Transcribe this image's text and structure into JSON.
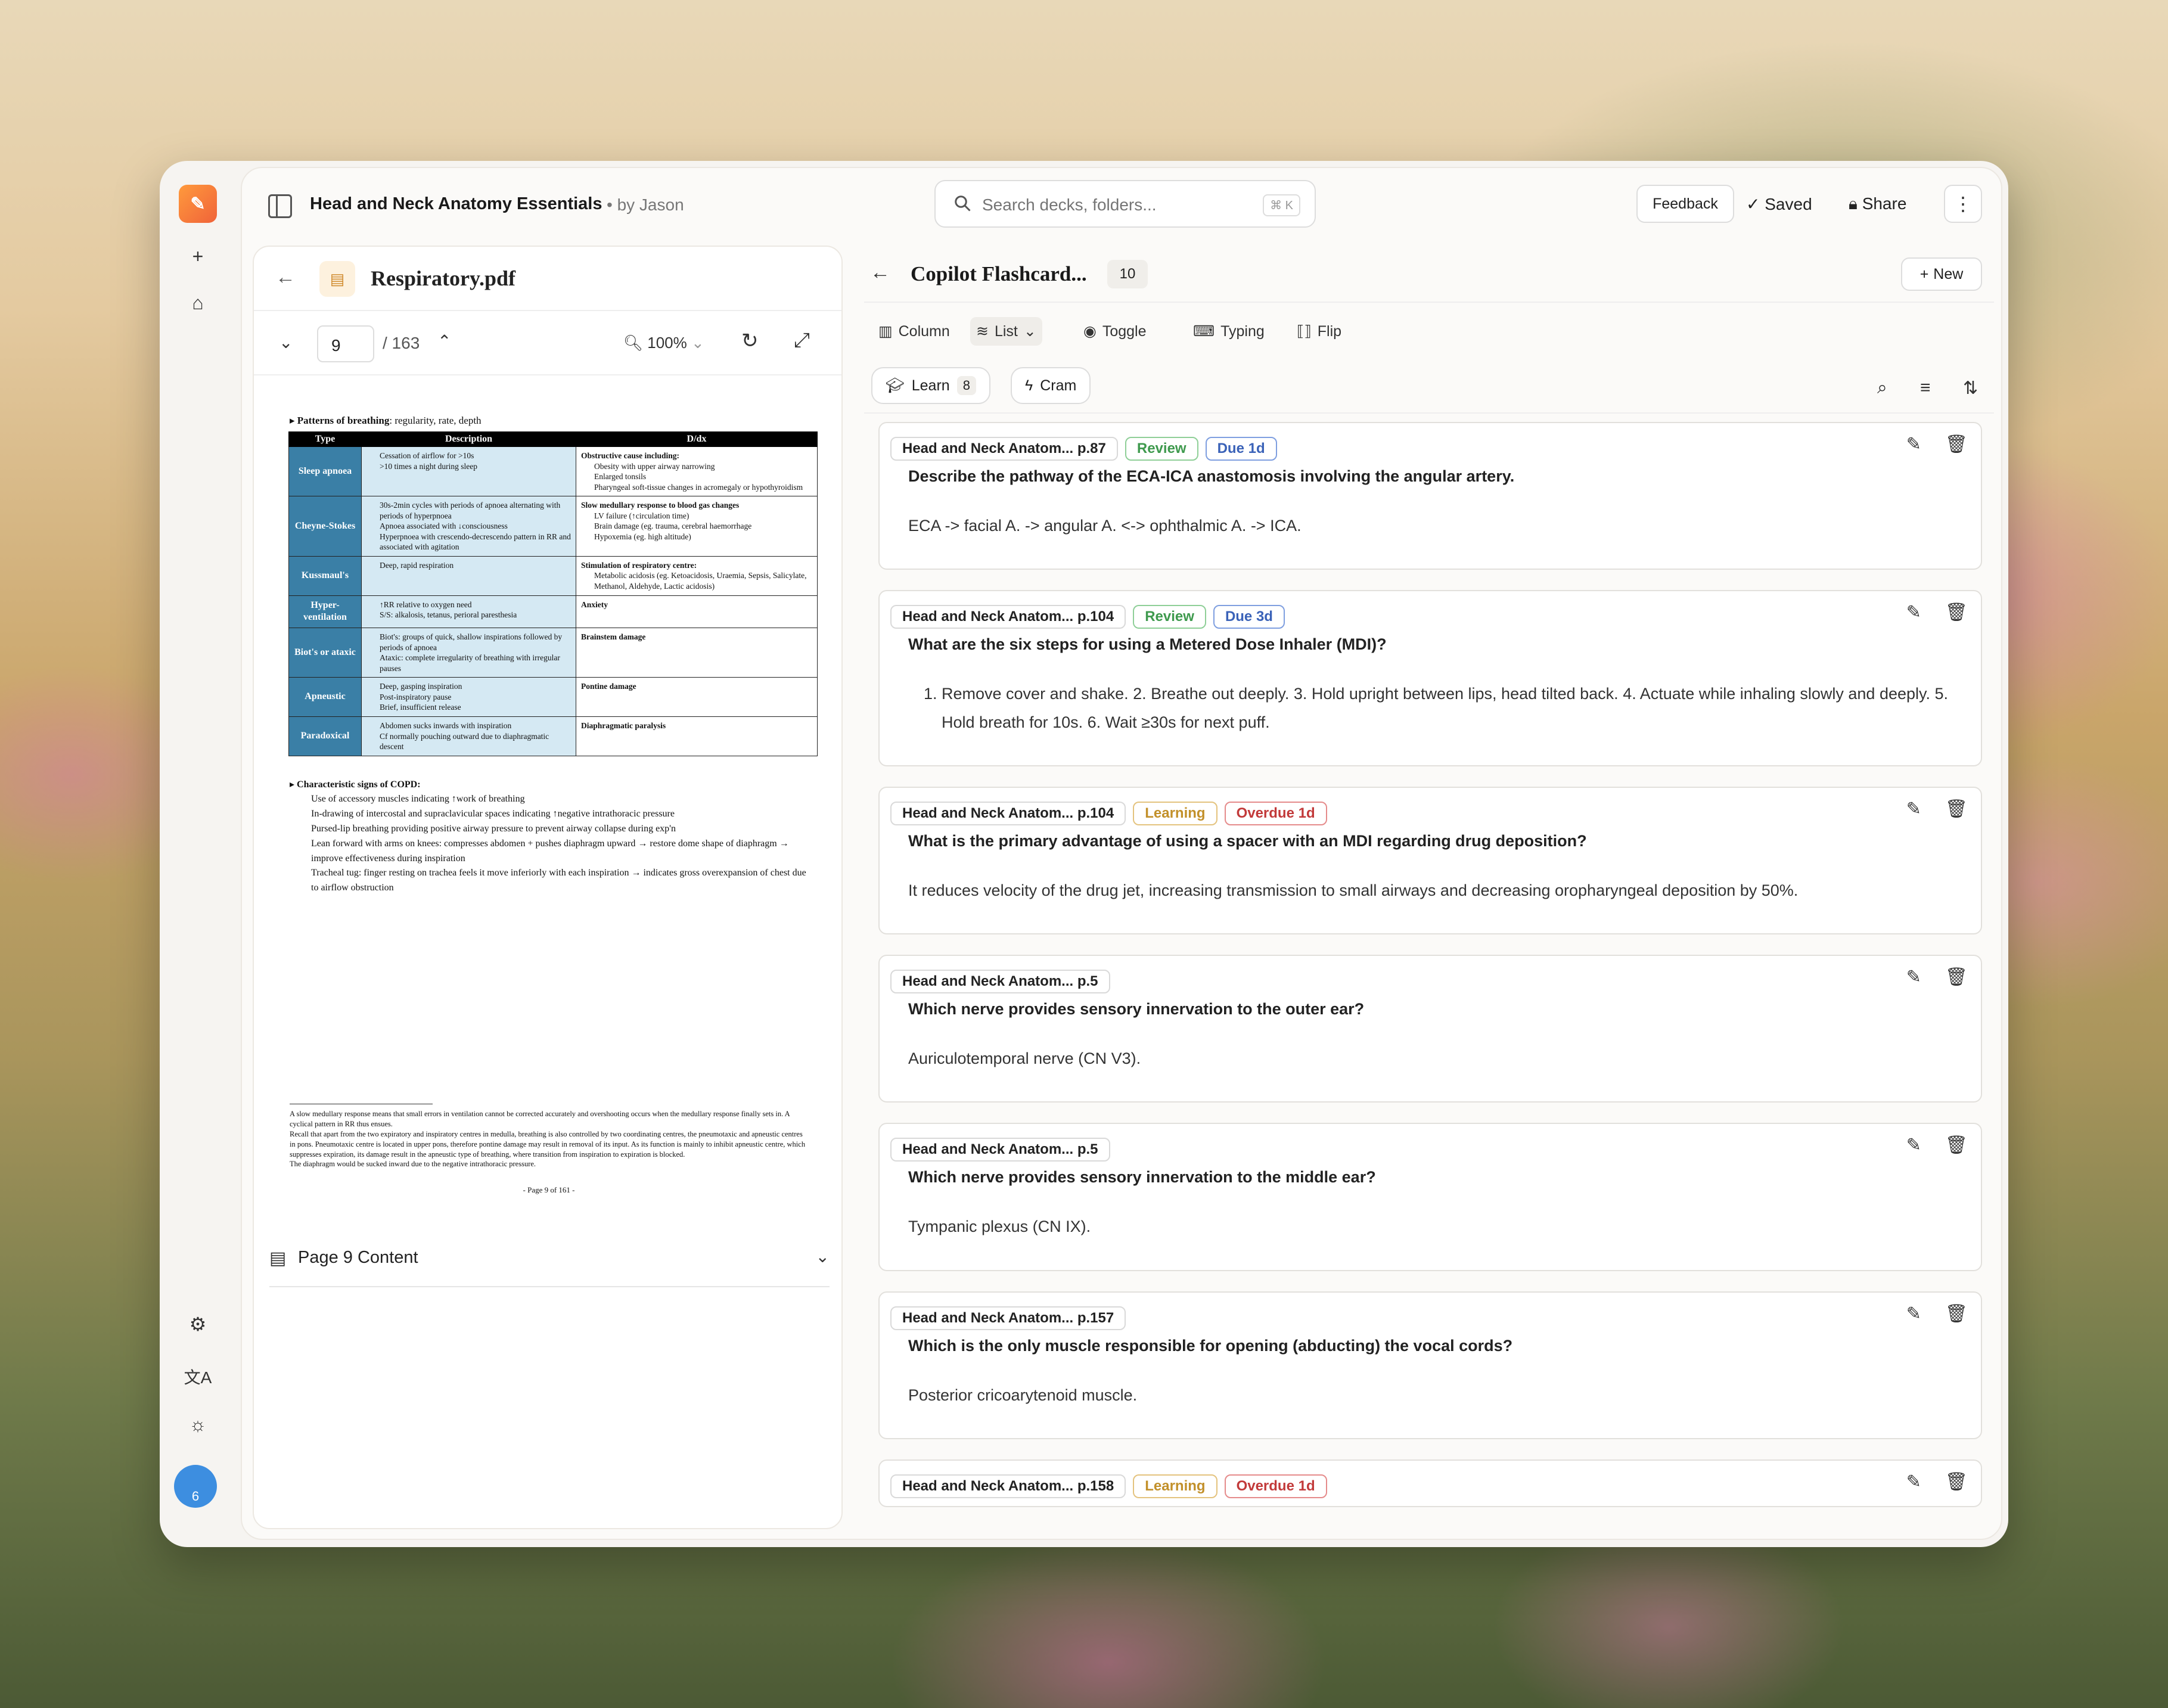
{
  "rail": {
    "logo": "logo",
    "icons": [
      "plus-icon",
      "home-icon",
      "gear-icon",
      "translate-icon",
      "sun-icon"
    ],
    "avatar_badge": "6"
  },
  "topbar": {
    "deck_title": "Head and Neck Anatomy Essentials",
    "author": "• by Jason",
    "search_placeholder": "Search decks, folders...",
    "search_shortcut": "⌘ K",
    "feedback": "Feedback",
    "saved": "Saved",
    "share": "Share"
  },
  "pdf": {
    "filename": "Respiratory.pdf",
    "page": "9",
    "total": "/ 163",
    "zoom": "100%",
    "content_label": "Page 9 Content",
    "page_doc": {
      "heading_bold": "Patterns of breathing",
      "heading_rest": ": regularity, rate, depth",
      "columns": [
        "Type",
        "Description",
        "D/dx"
      ],
      "rows": [
        {
          "type": "Sleep apnoea",
          "desc": [
            "Cessation of airflow for >10s",
            ">10 times a night during sleep"
          ],
          "ddx": [
            "Obstructive cause including:",
            "Obesity with upper airway narrowing",
            "Enlarged tonsils",
            "Pharyngeal soft-tissue changes in acromegaly or hypothyroidism"
          ]
        },
        {
          "type": "Cheyne-Stokes",
          "desc": [
            "30s-2min cycles with periods of apnoea alternating with periods of hyperpnoea",
            "Apnoea associated with ↓consciousness",
            "Hyperpnoea with crescendo-decrescendo pattern in RR and associated with agitation"
          ],
          "ddx": [
            "Slow medullary response to blood gas changes",
            "LV failure (↑circulation time)",
            "Brain damage (eg. trauma, cerebral haemorrhage",
            "Hypoxemia (eg. high altitude)"
          ]
        },
        {
          "type": "Kussmaul's",
          "desc": [
            "Deep, rapid respiration"
          ],
          "ddx": [
            "Stimulation of respiratory centre:",
            "Metabolic acidosis (eg. Ketoacidosis, Uraemia, Sepsis, Salicylate, Methanol, Aldehyde, Lactic acidosis)"
          ]
        },
        {
          "type": "Hyper-ventilation",
          "desc": [
            "↑RR relative to oxygen need",
            "S/S: alkalosis, tetanus, perioral paresthesia"
          ],
          "ddx": [
            "Anxiety"
          ]
        },
        {
          "type": "Biot's or ataxic",
          "desc": [
            "Biot's: groups of quick, shallow inspirations followed by periods of apnoea",
            "Ataxic: complete irregularity of breathing with irregular pauses"
          ],
          "ddx": [
            "Brainstem damage"
          ]
        },
        {
          "type": "Apneustic",
          "desc": [
            "Deep, gasping inspiration",
            "Post-inspiratory pause",
            "Brief, insufficient release"
          ],
          "ddx": [
            "Pontine damage"
          ]
        },
        {
          "type": "Paradoxical",
          "desc": [
            "Abdomen sucks inwards with inspiration",
            "Cf normally pouching outward due to diaphragmatic descent"
          ],
          "ddx": [
            "Diaphragmatic paralysis"
          ]
        }
      ],
      "copd_heading": "Characteristic signs of COPD:",
      "copd_items": [
        "Use of accessory muscles indicating ↑work of breathing",
        "In-drawing of intercostal and supraclavicular spaces indicating ↑negative intrathoracic pressure",
        "Pursed-lip breathing providing positive airway pressure to prevent airway collapse during exp'n",
        "Lean forward with arms on knees: compresses abdomen + pushes diaphragm upward → restore dome shape of diaphragm → improve effectiveness during inspiration",
        "Tracheal tug: finger resting on trachea feels it move inferiorly with each inspiration → indicates gross overexpansion of chest due to airflow obstruction"
      ],
      "footnotes": [
        "A slow medullary response means that small errors in ventilation cannot be corrected accurately and overshooting occurs when the medullary response finally sets in. A cyclical pattern in RR thus ensues.",
        "Recall that apart from the two expiratory and inspiratory centres in medulla, breathing is also controlled by two coordinating centres, the pneumotaxic and apneustic centres in pons. Pneumotaxic centre is located in upper pons, therefore pontine damage may result in removal of its input. As its function is mainly to inhibit apneustic centre, which suppresses expiration, its damage result in the apneustic type of breathing, where transition from inspiration to expiration is blocked.",
        "The diaphragm would be sucked inward due to the negative intrathoracic pressure."
      ],
      "page_label": "- Page 9 of 161 -"
    }
  },
  "flashcards": {
    "title": "Copilot Flashcard...",
    "count": "10",
    "new_label": "New",
    "views": [
      "Column",
      "List",
      "Toggle",
      "Typing",
      "Flip"
    ],
    "learn_label": "Learn",
    "learn_count": "8",
    "cram_label": "Cram",
    "cards": [
      {
        "source": "Head and Neck Anatom... p.87",
        "status": "Review",
        "due": "Due 1d",
        "question": "Describe the pathway of the ECA-ICA anastomosis involving the angular artery.",
        "answer": "ECA -> facial A. -> angular A. <-> ophthalmic A. -> ICA."
      },
      {
        "source": "Head and Neck Anatom... p.104",
        "status": "Review",
        "due": "Due 3d",
        "question": "What are the six steps for using a Metered Dose Inhaler (MDI)?",
        "answer": "Remove cover and shake. 2. Breathe out deeply. 3. Hold upright between lips, head tilted back. 4. Actuate while inhaling slowly and deeply. 5. Hold breath for 10s. 6. Wait ≥30s for next puff."
      },
      {
        "source": "Head and Neck Anatom... p.104",
        "status": "Learning",
        "due": "Overdue 1d",
        "question": "What is the primary advantage of using a spacer with an MDI regarding drug deposition?",
        "answer": "It reduces velocity of the drug jet, increasing transmission to small airways and decreasing oropharyngeal deposition by 50%."
      },
      {
        "source": "Head and Neck Anatom... p.5",
        "question": "Which nerve provides sensory innervation to the outer ear?",
        "answer": "Auriculotemporal nerve (CN V3)."
      },
      {
        "source": "Head and Neck Anatom... p.5",
        "question": "Which nerve provides sensory innervation to the middle ear?",
        "answer": "Tympanic plexus (CN IX)."
      },
      {
        "source": "Head and Neck Anatom... p.157",
        "question": "Which is the only muscle responsible for opening (abducting) the vocal cords?",
        "answer": "Posterior cricoarytenoid muscle."
      },
      {
        "source": "Head and Neck Anatom... p.158",
        "status": "Learning",
        "due": "Overdue 1d",
        "question": "",
        "answer": ""
      }
    ]
  }
}
